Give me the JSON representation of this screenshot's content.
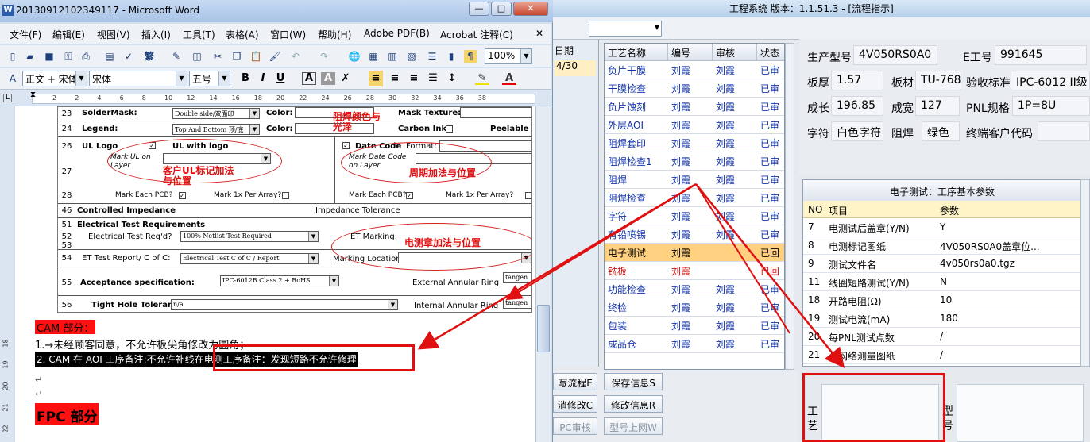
{
  "app": {
    "title": "工程系统  版本：1.1.51.3 - [流程指示]",
    "menu_help": "帮助",
    "menu_arrow": "▾",
    "date_col_head": "日期",
    "date_col_value": "4/30",
    "table_headers": [
      "工艺名称",
      "编号",
      "审核",
      "状态"
    ],
    "process_rows": [
      {
        "name": "负片干膜",
        "code": "刘霞",
        "review": "刘霞",
        "status": "已审",
        "state": "normal"
      },
      {
        "name": "干膜检查",
        "code": "刘霞",
        "review": "刘霞",
        "status": "已审",
        "state": "normal"
      },
      {
        "name": "负片蚀刻",
        "code": "刘霞",
        "review": "刘霞",
        "status": "已审",
        "state": "normal"
      },
      {
        "name": "外层AOI",
        "code": "刘霞",
        "review": "刘霞",
        "status": "已审",
        "state": "normal"
      },
      {
        "name": "阻焊套印",
        "code": "刘霞",
        "review": "刘霞",
        "status": "已审",
        "state": "normal"
      },
      {
        "name": "阻焊检查1",
        "code": "刘霞",
        "review": "刘霞",
        "status": "已审",
        "state": "normal"
      },
      {
        "name": "阻焊",
        "code": "刘霞",
        "review": "刘霞",
        "status": "已审",
        "state": "normal"
      },
      {
        "name": "阻焊检查",
        "code": "刘霞",
        "review": "刘霞",
        "status": "已审",
        "state": "normal"
      },
      {
        "name": "字符",
        "code": "刘霞",
        "review": "刘霞",
        "status": "已审",
        "state": "normal"
      },
      {
        "name": "有铅喷锡",
        "code": "刘霞",
        "review": "刘霞",
        "status": "已审",
        "state": "normal"
      },
      {
        "name": "电子测试",
        "code": "刘霞",
        "review": "",
        "status": "已回",
        "state": "selected"
      },
      {
        "name": "铣板",
        "code": "刘霞",
        "review": "",
        "status": "已回",
        "state": "red"
      },
      {
        "name": "功能检查",
        "code": "刘霞",
        "review": "刘霞",
        "status": "已审",
        "state": "normal"
      },
      {
        "name": "终检",
        "code": "刘霞",
        "review": "刘霞",
        "status": "已审",
        "state": "normal"
      },
      {
        "name": "包装",
        "code": "刘霞",
        "review": "刘霞",
        "status": "已审",
        "state": "normal"
      },
      {
        "name": "成品仓",
        "code": "刘霞",
        "review": "刘霞",
        "status": "已审",
        "state": "normal"
      }
    ],
    "buttons": {
      "write_flow": "写流程E",
      "save_info": "保存信息S",
      "cancel_edit": "消修改C",
      "edit_info": "修改信息R",
      "pc_review": "PC审核",
      "model_online": "型号上网W"
    },
    "info": {
      "model_label": "生产型号",
      "model_value": "4V050RS0A0",
      "eno_label": "E工号",
      "eno_value": "991645",
      "thick_label": "板厚",
      "thick_value": "1.57",
      "material_label": "板材",
      "material_value": "TU-768",
      "std_label": "验收标准",
      "std_value": "IPC-6012 II级",
      "len_label": "成长",
      "len_value": "196.85",
      "width_label": "成宽",
      "width_value": "127",
      "pnl_label": "PNL规格",
      "pnl_value": "1P=8U",
      "char_label": "字符",
      "char_value": "白色字符",
      "mask_label": "阻焊",
      "mask_value": "绿色",
      "cust_label": "终端客户代码",
      "cust_value": ""
    },
    "params": {
      "title": "电子测试：工序基本参数",
      "head_no": "NO",
      "head_item": "项目",
      "head_value": "参数",
      "rows": [
        {
          "no": "7",
          "item": "电测试后盖章(Y/N)",
          "value": "Y"
        },
        {
          "no": "8",
          "item": "电测标记图纸",
          "value": "4V050RS0A0盖章位..."
        },
        {
          "no": "9",
          "item": "测试文件名",
          "value": "4v050rs0a0.tgz"
        },
        {
          "no": "11",
          "item": "线圈短路测试(Y/N)",
          "value": "N"
        },
        {
          "no": "18",
          "item": "开路电阻(Ω)",
          "value": "10"
        },
        {
          "no": "19",
          "item": "测试电流(mA)",
          "value": "180"
        },
        {
          "no": "20",
          "item": "每PNL测试点数",
          "value": "/"
        },
        {
          "no": "21",
          "item": "长网络测量图纸",
          "value": "/"
        }
      ]
    },
    "bottom_label1": "工艺",
    "bottom_label2": "型号"
  },
  "word": {
    "title": "20130912102349117 - Microsoft Word",
    "menus": [
      "文件(F)",
      "编辑(E)",
      "视图(V)",
      "插入(I)",
      "工具(T)",
      "表格(A)",
      "窗口(W)",
      "帮助(H)",
      "Adobe PDF(B)",
      "Acrobat 注释(C)"
    ],
    "zoom": "100%",
    "style": "正文 + 宋体",
    "font": "宋体",
    "size": "五号",
    "ruler_numbers": [
      "2",
      "2",
      "4",
      "6",
      "8",
      "10",
      "12",
      "14",
      "16",
      "18",
      "20",
      "22",
      "24",
      "26",
      "28",
      "30",
      "32",
      "34",
      "36",
      "38"
    ],
    "vruler_numbers": [
      "18",
      "19",
      "20",
      "21",
      "22"
    ],
    "form": {
      "r23_label": "SolderMask:",
      "r23_select": "Double side/双面印",
      "r23_color": "Color:",
      "r23_texture": "Mask Texture:",
      "r24_label": "Legend:",
      "r24_select": "Top And Bottom 顶/底",
      "r24_color": "Color:",
      "r24_carbon": "Carbon Ink",
      "r24_peel": "Peelable m",
      "ann_mask": "阻焊颜色与\n光泽",
      "ul_logo": "UL Logo",
      "ul_with": "UL with logo",
      "mark_ul": "Mark UL on\nLayer",
      "ann_ul": "客户UL标记加法\n与位置",
      "date_code": "Date Code",
      "format": "Format:",
      "mark_date": "Mark Date Code\non Layer",
      "ann_date": "周期加法与位置",
      "each_pcb": "Mark Each PCB?",
      "per_array": "Mark 1x Per Array?",
      "each_pcb2": "Mark Each PCB?",
      "per_array2": "Mark 1x Per Array?",
      "controlled": "Controlled Impedance",
      "imp_tol": "Impedance Tolerance",
      "elec_req": "Electrical Test Requirements",
      "et_req": "Electrical Test Req'd?",
      "et_req_sel": "100% Netlist Test Required",
      "et_marking": "ET Marking:",
      "ann_et": "电测章加法与位置",
      "et_report": "ET Test Report/ C of C:",
      "et_report_sel": "Electrical Test C of C / Report",
      "marking_loc": "Marking Location:",
      "acceptance": "Acceptance specification:",
      "acceptance_sel": "IPC-6012B Class 2 + RoHS",
      "ext_ring": "External Annular Ring",
      "tang1": "tangen",
      "tight_hole": "Tight Hole Tolerance:",
      "tight_sel": "n/a",
      "int_ring": "Internal Annular Ring",
      "tang2": "tangen",
      "nums": [
        "23",
        "24",
        "26",
        "27",
        "28",
        "46",
        "51",
        "52",
        "53",
        "54",
        "55",
        "56"
      ]
    },
    "cam_title": "CAM 部分：",
    "line1": "1.→未经顾客同意，不允许板尖角修改为圆角；",
    "line2a": "2. CAM 在 AOI 工序备注:不允许补线",
    "line2b": "在电测工序备注：发现短路不允许修理",
    "fpc": "FPC 部分"
  },
  "colors": {
    "accent_red": "#e01010",
    "selected_row": "#ffd180",
    "link_blue": "#1133aa"
  }
}
